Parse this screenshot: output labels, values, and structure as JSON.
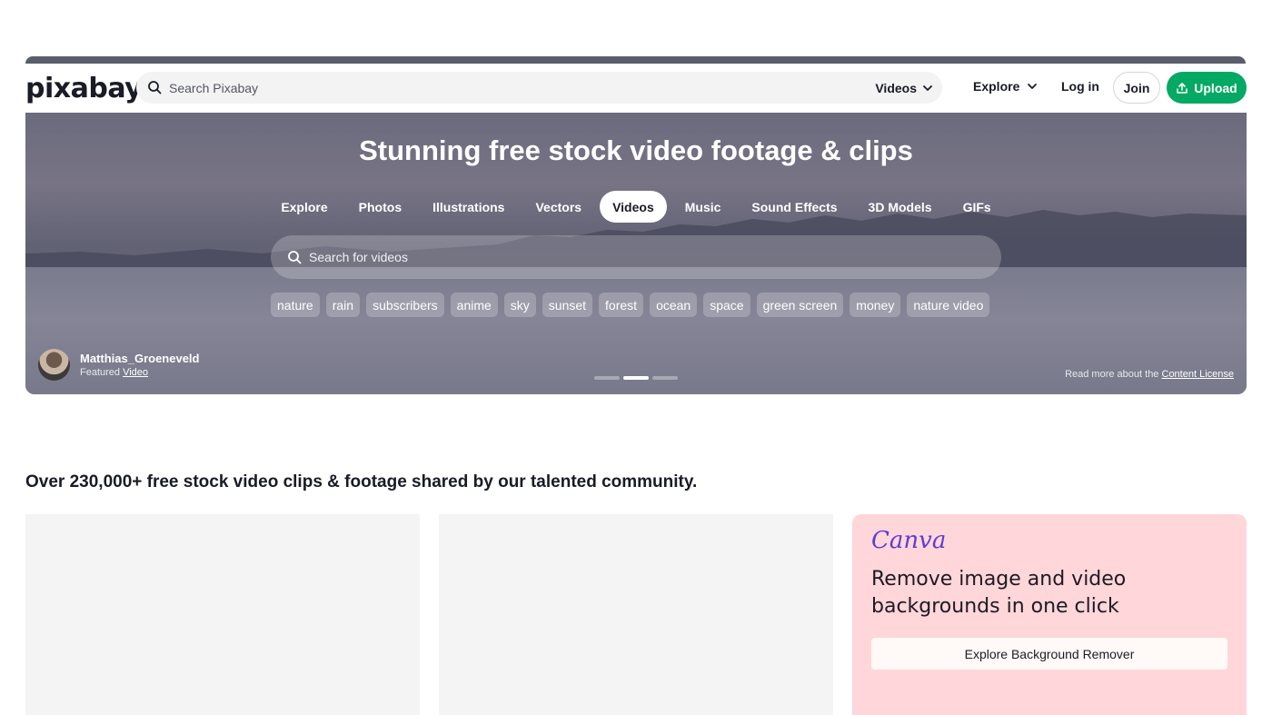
{
  "header": {
    "logo": "pixabay",
    "search_placeholder": "Search Pixabay",
    "media_type": "Videos",
    "explore_label": "Explore",
    "login_label": "Log in",
    "join_label": "Join",
    "upload_label": "Upload",
    "accent_color": "#04a964"
  },
  "hero": {
    "title": "Stunning free stock video footage & clips",
    "tabs": [
      {
        "label": "Explore"
      },
      {
        "label": "Photos"
      },
      {
        "label": "Illustrations"
      },
      {
        "label": "Vectors"
      },
      {
        "label": "Videos",
        "active": true
      },
      {
        "label": "Music"
      },
      {
        "label": "Sound Effects"
      },
      {
        "label": "3D Models"
      },
      {
        "label": "GIFs"
      }
    ],
    "search_placeholder": "Search for videos",
    "tags": [
      "nature",
      "rain",
      "subscribers",
      "anime",
      "sky",
      "sunset",
      "forest",
      "ocean",
      "space",
      "green screen",
      "money",
      "nature video"
    ],
    "credit": {
      "name": "Matthias_Groeneveld",
      "featured_prefix": "Featured",
      "featured_link": "Video"
    },
    "slides": {
      "count": 3,
      "active_index": 1
    },
    "license": {
      "prefix": "Read more about the",
      "link": "Content License"
    }
  },
  "main": {
    "subtitle": "Over 230,000+ free stock video clips & footage shared by our talented community."
  },
  "ad": {
    "brand": "Canva",
    "headline": "Remove image and video backgrounds in one click",
    "button_label": "Explore Background Remover",
    "background_color": "#ffd6d9"
  }
}
